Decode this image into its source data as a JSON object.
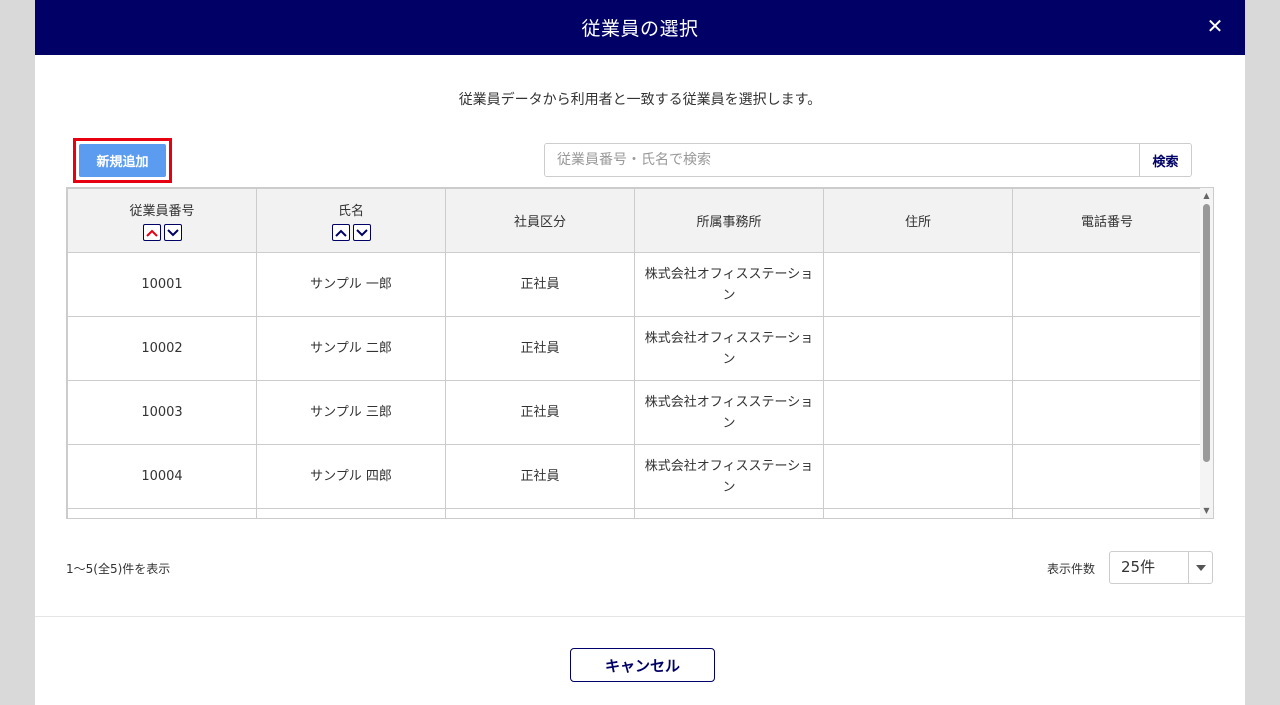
{
  "dialog": {
    "title": "従業員の選択",
    "close_symbol": "✕",
    "description": "従業員データから利用者と一致する従業員を選択します。"
  },
  "toolbar": {
    "add_label": "新規追加",
    "search_placeholder": "従業員番号・氏名で検索",
    "search_label": "検索"
  },
  "table": {
    "columns": [
      "従業員番号",
      "氏名",
      "社員区分",
      "所属事務所",
      "住所",
      "電話番号"
    ],
    "rows": [
      {
        "id": "10001",
        "name": "サンプル 一郎",
        "type": "正社員",
        "office": "株式会社オフィスステーション",
        "address": "",
        "phone": ""
      },
      {
        "id": "10002",
        "name": "サンプル 二郎",
        "type": "正社員",
        "office": "株式会社オフィスステーション",
        "address": "",
        "phone": ""
      },
      {
        "id": "10003",
        "name": "サンプル 三郎",
        "type": "正社員",
        "office": "株式会社オフィスステーション",
        "address": "",
        "phone": ""
      },
      {
        "id": "10004",
        "name": "サンプル 四郎",
        "type": "正社員",
        "office": "株式会社オフィスステーション",
        "address": "",
        "phone": ""
      }
    ]
  },
  "pagination": {
    "count_text": "1～5(全5)件を表示",
    "per_page_label": "表示件数",
    "per_page_value": "25件"
  },
  "footer": {
    "cancel_label": "キャンセル"
  },
  "colors": {
    "header_bg": "#000066",
    "add_button": "#5b9bf0",
    "highlight_border": "#e60012",
    "sort_up": "#e60012"
  },
  "icons": [
    "close-icon",
    "sort-up-icon",
    "sort-down-icon",
    "chevron-down-icon",
    "scroll-up-icon",
    "scroll-down-icon"
  ]
}
